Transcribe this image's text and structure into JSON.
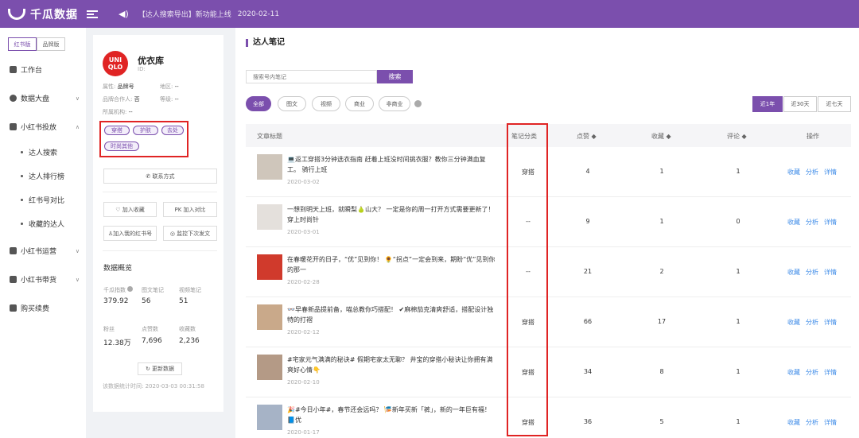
{
  "topbar": {
    "brand": "千瓜数据",
    "notice": "【达人搜索导出】新功能上线",
    "notice_date": "2020-02-11"
  },
  "sidebar": {
    "versions": [
      "红书版",
      "品牌版"
    ],
    "items": [
      {
        "label": "工作台",
        "icon": "dashboard-icon"
      },
      {
        "label": "数据大盘",
        "icon": "pie-chart-icon"
      },
      {
        "label": "小红书投放",
        "icon": "shield-icon"
      },
      {
        "label": "小红书运营",
        "icon": "calendar-icon"
      },
      {
        "label": "小红书带货",
        "icon": "shopping-bag-icon"
      },
      {
        "label": "购买续费",
        "icon": "cart-icon"
      }
    ],
    "sub_items": [
      "达人搜索",
      "达人排行榜",
      "红书号对比",
      "收藏的达人"
    ]
  },
  "profile": {
    "logo_line1": "UNI",
    "logo_line2": "QLO",
    "name": "优衣库",
    "id_label": "ID:",
    "attr_label": "属性:",
    "attr_value": "品牌号",
    "region_label": "地区:",
    "region_value": "--",
    "coop_label": "品牌合作人:",
    "coop_value": "否",
    "level_label": "等级:",
    "level_value": "--",
    "org_label": "所属机构:",
    "org_value": "--",
    "tags": [
      "穿搭",
      "护肤",
      "去处",
      "时尚其他"
    ],
    "contact": "联系方式",
    "favorite": "加入收藏",
    "compare": "加入对比",
    "add_account": "加入我的红书号",
    "monitor": "监控下次发文",
    "overview_title": "数据概览",
    "stats": [
      {
        "label": "千瓜指数",
        "value": "379.92"
      },
      {
        "label": "图文笔记",
        "value": "56"
      },
      {
        "label": "视频笔记",
        "value": "51"
      },
      {
        "label": "粉丝",
        "value": "12.38万"
      },
      {
        "label": "点赞数",
        "value": "7,696"
      },
      {
        "label": "收藏数",
        "value": "2,236"
      }
    ],
    "refresh": "更新数据",
    "updated_time": "该数据统计时间: 2020-03-03 00:31:58"
  },
  "main": {
    "title": "达人笔记",
    "search_placeholder": "搜索号内笔记",
    "search_btn": "搜索",
    "filters": [
      "全部",
      "图文",
      "视频",
      "商业",
      "非商业"
    ],
    "ranges": [
      "近1年",
      "近30天",
      "近七天"
    ],
    "columns": {
      "title": "文章标题",
      "category": "笔记分类",
      "likes": "点赞 ◆",
      "collects": "收藏 ◆",
      "comments": "评论 ◆",
      "actions": "操作"
    },
    "actions": [
      "收藏",
      "分析",
      "详情"
    ],
    "rows": [
      {
        "title": "💻返工穿搭3分钟选衣指南 赶着上班没时间挑衣服？教你三分钟满血复工。 骑行上班",
        "date": "2020-03-02",
        "category": "穿搭",
        "likes": "4",
        "collects": "1",
        "comments": "1",
        "thumb": "#cfc6bb"
      },
      {
        "title": "一想到明天上班，就瞬梨🍐山大？ 一定是你的周一打开方式需要更新了！穿上时尚针",
        "date": "2020-03-01",
        "category": "--",
        "likes": "9",
        "collects": "1",
        "comments": "0",
        "thumb": "#e4e0dc"
      },
      {
        "title": "在春暖花开的日子，“优”见到你！ 🌻“拐点”一定会到来，期盼“优”见到你的那一",
        "date": "2020-02-28",
        "category": "--",
        "likes": "21",
        "collects": "2",
        "comments": "1",
        "thumb": "#d03a2c"
      },
      {
        "title": "👓早春新品提前备，喵总教你巧搭配！ ✔麻棉茄克清爽舒适，搭配设计独特的打褶",
        "date": "2020-02-12",
        "category": "穿搭",
        "likes": "66",
        "collects": "17",
        "comments": "1",
        "thumb": "#c9a98a"
      },
      {
        "title": "#宅家元气满满的秘诀# 假期宅家太无聊？ 井宝的穿搭小秘诀让你拥有满爽好心情👇",
        "date": "2020-02-10",
        "category": "穿搭",
        "likes": "34",
        "collects": "8",
        "comments": "1",
        "thumb": "#b49a86"
      },
      {
        "title": "🎉#今日小年#，春节还会远吗？ 🎏新年买新「裤」，新的一年巨有福！ 📘优",
        "date": "2020-01-17",
        "category": "穿搭",
        "likes": "36",
        "collects": "5",
        "comments": "1",
        "thumb": "#a6b3c6"
      }
    ]
  },
  "colors": {
    "accent": "#7b4fad",
    "highlight": "#e02424",
    "link": "#3d8be8"
  }
}
